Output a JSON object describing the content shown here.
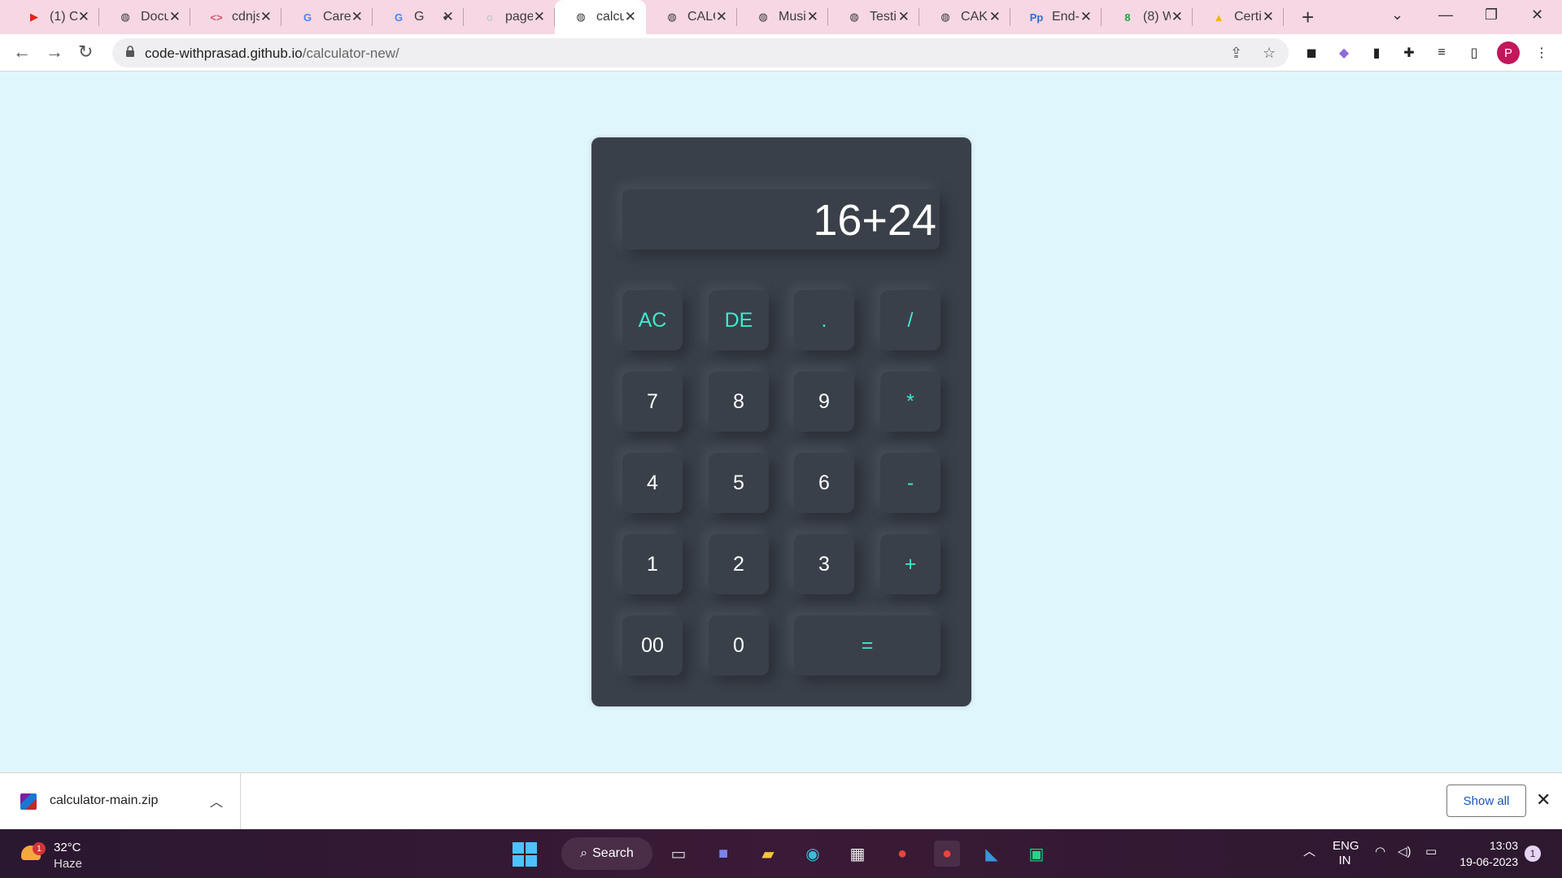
{
  "browser": {
    "tabs": [
      {
        "title": "(1) C",
        "favicon": "youtube-icon"
      },
      {
        "title": "Docu",
        "favicon": "globe-icon"
      },
      {
        "title": "cdnjs",
        "favicon": "code-icon"
      },
      {
        "title": "Care",
        "favicon": "google-icon"
      },
      {
        "title": "G",
        "favicon": "google-icon",
        "audio": true
      },
      {
        "title": "page",
        "favicon": "loading-icon"
      },
      {
        "title": "calcu",
        "favicon": "globe-icon",
        "active": true
      },
      {
        "title": "CALC",
        "favicon": "globe-icon"
      },
      {
        "title": "Musi",
        "favicon": "globe-icon"
      },
      {
        "title": "Testi",
        "favicon": "globe-icon"
      },
      {
        "title": "CAKE",
        "favicon": "globe-icon"
      },
      {
        "title": "End-",
        "favicon": "pp-icon"
      },
      {
        "title": "(8) W",
        "favicon": "whatsapp-icon"
      },
      {
        "title": "Certi",
        "favicon": "drive-icon"
      }
    ],
    "url_host": "code-withprasad.github.io",
    "url_path": "/calculator-new/",
    "profile_initial": "P"
  },
  "calculator": {
    "display": "16+24",
    "keys": [
      {
        "label": "AC",
        "type": "op"
      },
      {
        "label": "DE",
        "type": "op"
      },
      {
        "label": ".",
        "type": "op"
      },
      {
        "label": "/",
        "type": "op"
      },
      {
        "label": "7",
        "type": "num"
      },
      {
        "label": "8",
        "type": "num"
      },
      {
        "label": "9",
        "type": "num"
      },
      {
        "label": "*",
        "type": "op"
      },
      {
        "label": "4",
        "type": "num"
      },
      {
        "label": "5",
        "type": "num"
      },
      {
        "label": "6",
        "type": "num"
      },
      {
        "label": "-",
        "type": "op"
      },
      {
        "label": "1",
        "type": "num"
      },
      {
        "label": "2",
        "type": "num"
      },
      {
        "label": "3",
        "type": "num"
      },
      {
        "label": "+",
        "type": "op"
      },
      {
        "label": "00",
        "type": "num"
      },
      {
        "label": "0",
        "type": "num"
      },
      {
        "label": "=",
        "type": "op"
      }
    ],
    "colors": {
      "body": "#3a4049",
      "operator": "#3ee8cf",
      "number": "#ffffff",
      "page_bg": "#e0f6fd"
    }
  },
  "downloads": {
    "file_name": "calculator-main.zip",
    "show_all_label": "Show all"
  },
  "taskbar": {
    "weather_temp": "32°C",
    "weather_condition": "Haze",
    "weather_badge": "1",
    "search_label": "Search",
    "lang_line1": "ENG",
    "lang_line2": "IN",
    "time": "13:03",
    "date": "19-06-2023",
    "notification_count": "1"
  }
}
